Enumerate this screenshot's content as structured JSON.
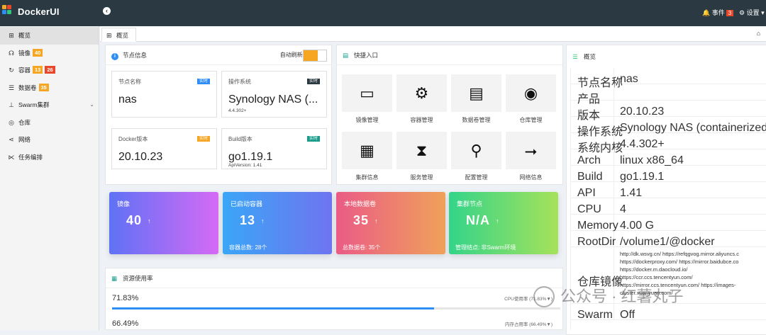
{
  "app": {
    "title": "DockerUI"
  },
  "topbar": {
    "events_label": "事件",
    "events_count": "3",
    "settings_label": "设置"
  },
  "sidebar": {
    "items": [
      {
        "label": "概览",
        "icon": "windows-icon"
      },
      {
        "label": "镜像",
        "icon": "headphones-icon",
        "badge": "40"
      },
      {
        "label": "容器",
        "icon": "refresh-icon",
        "badge": "13",
        "badge2": "26"
      },
      {
        "label": "数据卷",
        "icon": "database-icon",
        "badge": "35"
      },
      {
        "label": "Swarm集群",
        "icon": "sitemap-icon"
      },
      {
        "label": "仓库",
        "icon": "globe-icon"
      },
      {
        "label": "网络",
        "icon": "network-icon"
      },
      {
        "label": "任务编排",
        "icon": "share-icon"
      }
    ]
  },
  "tabs": [
    {
      "label": "概览"
    }
  ],
  "node_info": {
    "title": "节点信息",
    "auto_refresh_label": "自动刷新:",
    "cards": [
      {
        "label": "节点名称",
        "tag": "实时",
        "value": "nas",
        "sub": ""
      },
      {
        "label": "操作系统",
        "tag": "实时",
        "value": "Synology NAS (...",
        "sub": "4.4.302+"
      },
      {
        "label": "Docker版本",
        "tag": "实时",
        "value": "20.10.23",
        "sub": ""
      },
      {
        "label": "Build版本",
        "tag": "实时",
        "value": "go1.19.1",
        "sub": "ApiVersion: 1.41"
      }
    ]
  },
  "quick": {
    "title": "快捷入口",
    "items": [
      {
        "label": "镜像管理",
        "glyph": "▭",
        "icon": "window-icon"
      },
      {
        "label": "容器管理",
        "glyph": "⚙",
        "icon": "gears-icon"
      },
      {
        "label": "数据卷管理",
        "glyph": "▤",
        "icon": "document-icon"
      },
      {
        "label": "仓库管理",
        "glyph": "◉",
        "icon": "target-icon"
      },
      {
        "label": "集群信息",
        "glyph": "▦",
        "icon": "calendar-icon"
      },
      {
        "label": "服务管理",
        "glyph": "⧗",
        "icon": "hourglass-icon"
      },
      {
        "label": "配置管理",
        "glyph": "⚲",
        "icon": "search-icon"
      },
      {
        "label": "网络信息",
        "glyph": "⭢",
        "icon": "usb-icon"
      }
    ]
  },
  "stats": [
    {
      "title": "镜像",
      "value": "40",
      "footer": "",
      "colors": [
        "#5e72f5",
        "#d66af5"
      ]
    },
    {
      "title": "已启动容器",
      "value": "13",
      "footer": "容器总数: 28个",
      "colors": [
        "#3aa6f7",
        "#6f74f0"
      ]
    },
    {
      "title": "本地数据卷",
      "value": "35",
      "footer": "总数据卷: 35个",
      "colors": [
        "#ea5b86",
        "#f0a15a"
      ]
    },
    {
      "title": "集群节点",
      "value": "N/A",
      "footer": "管理结点: 非Swarm环境",
      "colors": [
        "#33d48a",
        "#a6e25a"
      ]
    }
  ],
  "resources": {
    "title": "资源使用率",
    "rows": [
      {
        "percent": "71.83%",
        "label": "CPU使用率 (71.83%▼)",
        "fill": 0.7183
      },
      {
        "percent": "66.49%",
        "label": "内存占用率 (66.49%▼)",
        "fill": 0.6649
      }
    ]
  },
  "overview": {
    "title": "概览",
    "rows": [
      {
        "key": "节点名称",
        "value": "nas"
      },
      {
        "key": "产品",
        "value": ""
      },
      {
        "key": "版本",
        "value": "20.10.23"
      },
      {
        "key": "操作系统",
        "value": "Synology NAS (containerized)"
      },
      {
        "key": "系统内核",
        "value": "4.4.302+"
      },
      {
        "key": "Arch",
        "value": "linux x86_64"
      },
      {
        "key": "Build",
        "value": "go1.19.1"
      },
      {
        "key": "API",
        "value": "1.41"
      },
      {
        "key": "CPU",
        "value": "4"
      },
      {
        "key": "Memory",
        "value": "4.00 G"
      },
      {
        "key": "RootDir",
        "value": "/volume1/@docker"
      }
    ],
    "mirrors_key": "仓库镜像",
    "mirrors": [
      "http://dk.wsvg.cn/ https://refqgvog.mirror.aliyuncs.c",
      "https://dockerproxy.com/ https://mirror.baidubce.co",
      "https://docker.m.daocloud.io/",
      "https://ccr.ccs.tencentyun.com/",
      "https://mirror.ccs.tencentyun.com/ https://images-",
      "cluster.xuanyuan.com/"
    ],
    "swarm_key": "Swarm",
    "swarm_value": "Off"
  },
  "watermark": "公众号 · 红薯丸子",
  "colors": {
    "topbar": "#2b3a42",
    "accent": "#2f8ef5",
    "orange": "#f6a623",
    "red": "#e8472a"
  }
}
